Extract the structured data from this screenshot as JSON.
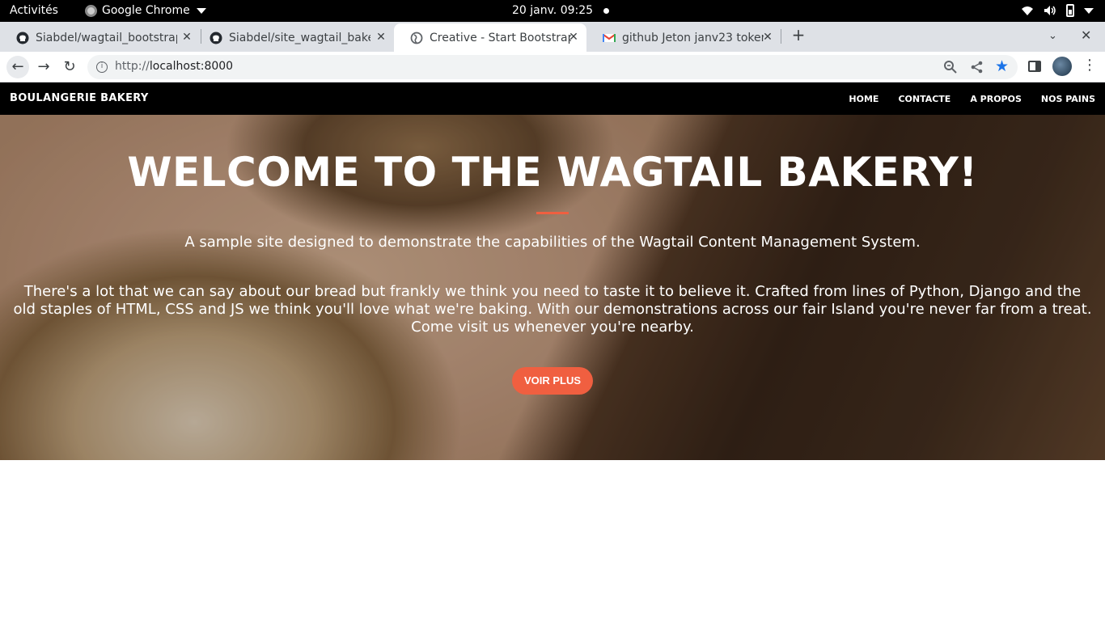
{
  "system": {
    "activities": "Activités",
    "app_name": "Google Chrome",
    "clock": "20 janv.  09:25"
  },
  "browser": {
    "tabs": [
      {
        "title": "Siabdel/wagtail_bootstrap",
        "icon": "github-icon"
      },
      {
        "title": "Siabdel/site_wagtail_bakery",
        "icon": "github-icon"
      },
      {
        "title": "Creative - Start Bootstrap",
        "icon": "globe-icon",
        "active": true
      },
      {
        "title": "github Jeton janv23 token",
        "icon": "gmail-icon"
      }
    ],
    "url_scheme": "http://",
    "url_host": "localhost:8000"
  },
  "site": {
    "brand": "BOULANGERIE BAKERY",
    "nav": [
      "HOME",
      "CONTACTE",
      "A PROPOS",
      "NOS PAINS"
    ],
    "hero": {
      "title": "WELCOME TO THE WAGTAIL BAKERY!",
      "lead": "A sample site designed to demonstrate the capabilities of the Wagtail Content Management System.",
      "body": "There's a lot that we can say about our bread but frankly we think you need to taste it to believe it. Crafted from lines of Python, Django and the old staples of HTML, CSS and JS we think you'll love what we're baking. With our demonstrations across our fair Island you're never far from a treat. Come visit us whenever you're nearby.",
      "cta": "VOIR PLUS"
    },
    "accent_color": "#f05f40"
  }
}
